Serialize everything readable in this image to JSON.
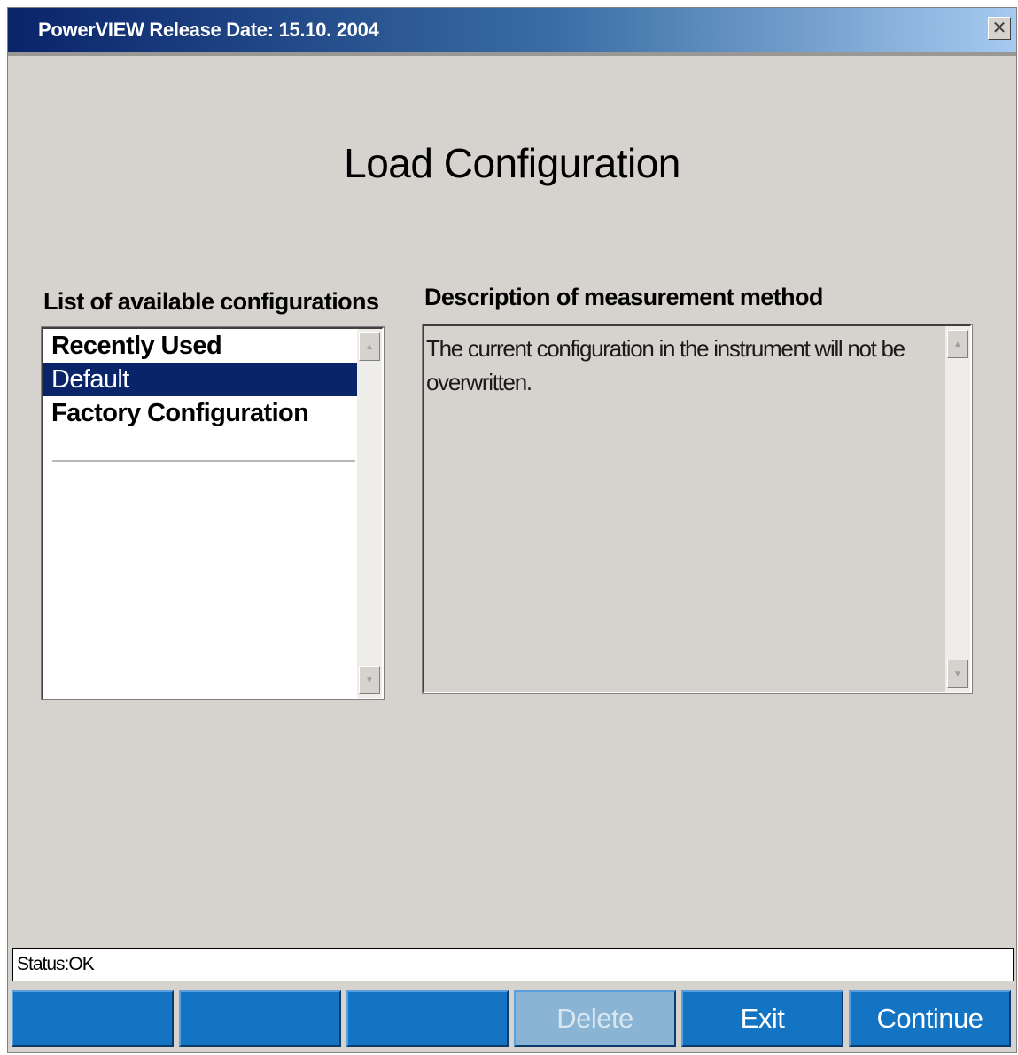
{
  "window": {
    "title": "PowerVIEW Release Date: 15.10. 2004",
    "close_glyph": "✕"
  },
  "main": {
    "heading": "Load Configuration",
    "list_label": "List of available configurations",
    "description_label": "Description of measurement method",
    "configurations": [
      {
        "label": "Recently Used",
        "selected": false
      },
      {
        "label": "Default",
        "selected": true
      },
      {
        "label": "Factory Configuration",
        "selected": false
      }
    ],
    "description": "The current configuration in the instrument will not be overwritten."
  },
  "scrollbar": {
    "up_glyph": "▲",
    "down_glyph": "▼"
  },
  "status": {
    "text": "Status:OK"
  },
  "buttons": [
    {
      "label": "",
      "enabled": true
    },
    {
      "label": "",
      "enabled": true
    },
    {
      "label": "",
      "enabled": true
    },
    {
      "label": "Delete",
      "enabled": false
    },
    {
      "label": "Exit",
      "enabled": true
    },
    {
      "label": "Continue",
      "enabled": true
    }
  ],
  "colors": {
    "selection": "#0a246a",
    "button": "#1474c4",
    "button_disabled": "#8ab4d4",
    "dialog_bg": "#d6d3ce"
  }
}
